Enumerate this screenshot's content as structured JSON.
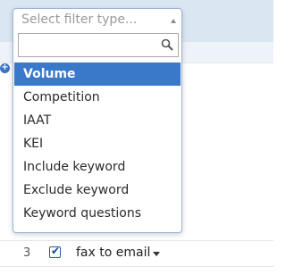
{
  "filter_select": {
    "placeholder": "Select filter type...",
    "search_value": "",
    "options": [
      {
        "label": "Volume",
        "selected": true
      },
      {
        "label": "Competition",
        "selected": false
      },
      {
        "label": "IAAT",
        "selected": false
      },
      {
        "label": "KEI",
        "selected": false
      },
      {
        "label": "Include keyword",
        "selected": false
      },
      {
        "label": "Exclude keyword",
        "selected": false
      },
      {
        "label": "Keyword questions",
        "selected": false
      }
    ]
  },
  "table_row": {
    "number": "3",
    "checked": true,
    "keyword": "fax to email"
  },
  "colors": {
    "accent": "#3a78c9",
    "header_bg": "#dbe6f3",
    "dropdown_border": "#9ab3d6"
  },
  "icons": {
    "add": "plus-circle-icon",
    "search": "magnifier-icon",
    "select_arrow": "triangle-up-icon",
    "row_menu": "caret-down-icon"
  }
}
